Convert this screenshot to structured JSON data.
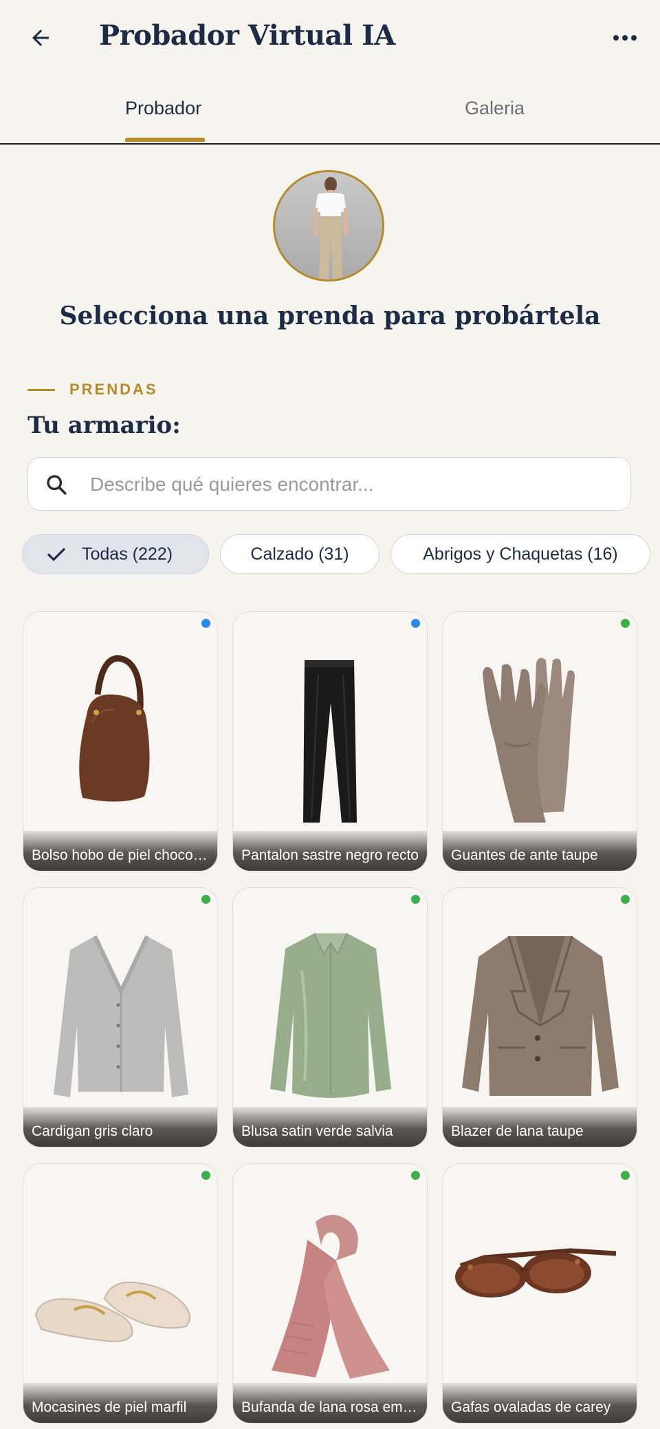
{
  "header": {
    "title": "Probador Virtual IA",
    "back_icon": "arrow-left-icon",
    "more_icon": "more-horizontal-icon"
  },
  "tabs": [
    {
      "label": "Probador",
      "active": true
    },
    {
      "label": "Galeria",
      "active": false
    }
  ],
  "colors": {
    "accent": "#b48a2b",
    "navy": "#1d2b45",
    "background": "#f6f4ef",
    "status_blue": "#2a8be6",
    "status_green": "#3dae4c"
  },
  "headline": "Selecciona una prenda para probártela",
  "section": {
    "label": "PRENDAS",
    "title": "Tu armario:"
  },
  "search": {
    "placeholder": "Describe qué quieres encontrar...",
    "value": ""
  },
  "chips": [
    {
      "label": "Todas (222)",
      "selected": true
    },
    {
      "label": "Calzado (31)",
      "selected": false
    },
    {
      "label": "Abrigos y Chaquetas (16)",
      "selected": false
    }
  ],
  "items": [
    {
      "name": "Bolso hobo de piel chocolate",
      "status": "blue"
    },
    {
      "name": "Pantalon sastre negro recto",
      "status": "blue"
    },
    {
      "name": "Guantes de ante taupe",
      "status": "green"
    },
    {
      "name": "Cardigan gris claro",
      "status": "green"
    },
    {
      "name": "Blusa satin verde salvia",
      "status": "green"
    },
    {
      "name": "Blazer de lana taupe",
      "status": "green"
    },
    {
      "name": "Mocasines de piel marfil",
      "status": "green"
    },
    {
      "name": "Bufanda de lana rosa empolvado",
      "status": "green"
    },
    {
      "name": "Gafas ovaladas de carey",
      "status": "green"
    }
  ]
}
